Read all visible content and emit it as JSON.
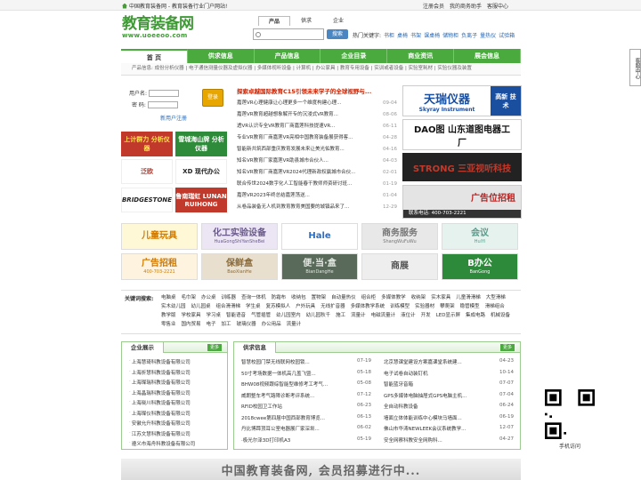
{
  "topbar": {
    "site_text": "中国教育装备网 - 教育装备行业门户网站!",
    "links": [
      "注册会员",
      "我的商务助手",
      "客服中心"
    ]
  },
  "logo": {
    "cn": "教育装备网",
    "en": "www.uoeeoo.com"
  },
  "search": {
    "tabs": [
      "产品",
      "供求",
      "企业"
    ],
    "button": "搜索",
    "hot_label": "热门关键字:",
    "hot_keywords": [
      "书柜",
      "桌椅",
      "书架",
      "课桌椅",
      "储物柜",
      "负离子",
      "量热仪",
      "试验箱"
    ]
  },
  "nav": [
    "首 页",
    "供求信息",
    "产品信息",
    "企业目录",
    "商业资讯",
    "展会信息"
  ],
  "subnav": "产品信息: 成份分析仪器 | 电子通信测量仪器及虚拟仪器 | 多媒体视听设备 | 计算机 | 办公家具 | 教育专用设备 | 实训或者设备 | 实验室耗材 | 实验仪器及装置",
  "login": {
    "user_label": "用户名:",
    "pass_label": "密 码:",
    "button": "登录",
    "register": "新用户注册"
  },
  "left_logos": [
    {
      "text": "上计群力 分析仪器",
      "bg": "#c0392b",
      "fg": "#ffe34d"
    },
    {
      "text": "雪城海山牌 分析仪器",
      "bg": "#2e8b3a",
      "fg": "#ffffff"
    },
    {
      "text": "泛欧",
      "bg": "#ffffff",
      "fg": "#c0392b"
    },
    {
      "text": "XD 现代办公",
      "bg": "#ffffff",
      "fg": "#222222"
    },
    {
      "text": "BRIDGESTONE",
      "bg": "#ffffff",
      "fg": "#222222"
    },
    {
      "text": "鲁南瑞虹 LUNAN RUIHONG",
      "bg": "#c0392b",
      "fg": "#ffffff"
    }
  ],
  "news": {
    "title": "探索卓越国际教育C15引领未来学子的全球视野与...",
    "items": [
      {
        "t": "嘉莲VR心理健康让心理更多一个维度构建心理...",
        "d": "09-04"
      },
      {
        "t": "嘉莲VR教育超越想象解开专的沉浸式VR教育...",
        "d": "08-06"
      },
      {
        "t": "透VR认识专全VR教育厂商嘉莲科技提速VR...",
        "d": "06-11"
      },
      {
        "t": "专业VR教育厂商嘉莲VR亮相中国教育装备展获得客...",
        "d": "04-28"
      },
      {
        "t": "智能新共筑西部重庆教育发展未来让美光佑教育...",
        "d": "04-16"
      },
      {
        "t": "知名VR教育厂家嘉莲VR助县城市合伙人...",
        "d": "04-03"
      },
      {
        "t": "知名VR教育厂商嘉莲VR2024代理新政权赢城市合伙...",
        "d": "02-01"
      },
      {
        "t": "联合传世2024数字化人工智能春干教师师资研讨班...",
        "d": "01-19"
      },
      {
        "t": "嘉莲VR2023年终总结嘉莲荡送...",
        "d": "01-04"
      },
      {
        "t": "从卷品装备无人机到教育教育美国要的城镇品来了...",
        "d": "12-29"
      }
    ]
  },
  "right_ads": [
    {
      "a": "天瑞仪器",
      "b": "Skyray Instrument",
      "c": "高新 技术"
    },
    {
      "a": "DAO图 山东道图电器工厂"
    },
    {
      "a": "STRONG 三亚视听科技"
    },
    {
      "a": "广告位招租",
      "b": "联系电话: 400-703-2221"
    }
  ],
  "banners": [
    {
      "a": "儿童玩具",
      "b": "",
      "bg": "#fff8d6",
      "fg": "#d07a00"
    },
    {
      "a": "化工实验设备",
      "b": "HuaGongShiYanSheBei",
      "bg": "#ece6f4",
      "fg": "#6a5a8a"
    },
    {
      "a": "Hale",
      "b": "",
      "bg": "#ffffff",
      "fg": "#2d6dc3"
    },
    {
      "a": "商务服务",
      "b": "ShangWuFuWu",
      "bg": "#e8e8e8",
      "fg": "#777777"
    },
    {
      "a": "会议",
      "b": "HuiYi",
      "bg": "#e6f2ee",
      "fg": "#5a9a8a"
    },
    {
      "a": "广告招租",
      "b": "400-703-2221",
      "bg": "#fdf3df",
      "fg": "#d07a00"
    },
    {
      "a": "保鲜盒",
      "b": "BaoXianHe",
      "bg": "#e8dfcf",
      "fg": "#8a6a3a"
    },
    {
      "a": "便·当·盒",
      "b": "BianDangHe",
      "bg": "#5a6a5a",
      "fg": "#dfe6df"
    },
    {
      "a": "商展",
      "b": "",
      "bg": "#eeeeee",
      "fg": "#555555"
    },
    {
      "a": "B办公",
      "b": "BanGong",
      "bg": "#2d8a3a",
      "fg": "#ffffff"
    }
  ],
  "keywords": {
    "label": "关键词搜索:",
    "items": [
      "电脑桌",
      "毛巾架",
      "办公桌",
      "训练器",
      "查询一体机",
      "防霜布",
      "收纳包",
      "置物架",
      "自动量热仪",
      "组合柜",
      "多媒体教学",
      "收纳架",
      "实木家具",
      "儿童滑滑梯",
      "大型滑梯",
      "实木幼儿园",
      "幼儿园桌",
      "组合滑滑梯",
      "学生桌",
      "复苏模拟人",
      "户外玩具",
      "无线扩音器",
      "多媒体教学系统",
      "训练模型",
      "实验器材",
      "攀爬架",
      "稳管模型",
      "滑梯组合",
      "教学版",
      "学校家具",
      "学习桌",
      "智能语音",
      "气管插管",
      "幼儿园室内",
      "幼儿园秋千",
      "施工",
      "流量计",
      "电磁流量计",
      "液位计",
      "开发",
      "LED显示屏",
      "集成电路",
      "机械设备",
      "零售业",
      "国内贸易",
      "电子",
      "加工",
      "玻璃仪器",
      "办公用品",
      "流量计"
    ]
  },
  "companies": {
    "title": "企业展示",
    "more": "更多",
    "items": [
      "上海慧琦科教设备有限公司",
      "上海折慧科教设备有限公司",
      "上海璨瑞科教设备有限公司",
      "上海晶瑞科教设备有限公司",
      "上海晓川科教设备有限公司",
      "上海璨仪科教设备有限公司",
      "安徽允升科教设备有限公司",
      "江苏文慧科教设备有限公司",
      "遵义市海舟科教设备有限公司"
    ]
  },
  "supply": {
    "title": "供求信息",
    "more": "更多",
    "col1": [
      {
        "t": "智慧校园门禁无线联网校园锁...",
        "d": "07-19"
      },
      {
        "t": "50寸考场数据一体机高几盖飞暨...",
        "d": "05-18"
      },
      {
        "t": "BHW08视频跟综智能型维修考工考气...",
        "d": "05-08"
      },
      {
        "t": "威朗整车考气路障诊断考评系统...",
        "d": "07-12"
      },
      {
        "t": "RFID校园卫工作站",
        "d": "06-23"
      },
      {
        "t": "2018cwee第四届中国西部教育博览...",
        "d": "06-13"
      },
      {
        "t": "丹比博蹄顶耳公室电器展厂家深圳...",
        "d": "06-02"
      },
      {
        "t": "·极光尔泽3D打印机A3",
        "d": "05-19"
      }
    ],
    "col2": [
      {
        "t": "北京慧课堂建设方案嘉课堂系统建...",
        "d": "04-23"
      },
      {
        "t": "电子试卷自动装钉机",
        "d": "10-14"
      },
      {
        "t": "智能蓝牙音箱",
        "d": "07-07"
      },
      {
        "t": "GPS多媒体电脑抽屉式GPS电脑主机...",
        "d": "07-04"
      },
      {
        "t": "全自动科教设备",
        "d": "06-24"
      },
      {
        "t": "墙面立体体能训练中心模块马墙面...",
        "d": "06-19"
      },
      {
        "t": "佛山市华涛NEWLEEK会议系统教学...",
        "d": "12-07"
      },
      {
        "t": "安全网察科教安全网购科...",
        "d": "04-27"
      }
    ]
  },
  "float_panel": "客服中心",
  "qr_label": "手机访问",
  "bottom_banner": "中国教育装备网, 会员招募进行中..."
}
